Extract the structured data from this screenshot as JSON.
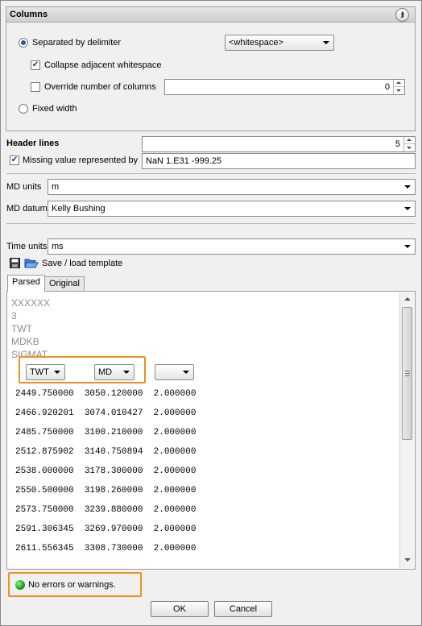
{
  "columns_group": {
    "title": "Columns",
    "separated_label": "Separated by delimiter",
    "delimiter_value": "<whitespace>",
    "collapse_label": "Collapse adjacent whitespace",
    "override_label": "Override number of columns",
    "override_value": "0",
    "fixed_width_label": "Fixed width"
  },
  "header_lines": {
    "label": "Header lines",
    "value": "5"
  },
  "missing_value": {
    "label": "Missing value represented by",
    "value": "NaN 1.E31 -999.25"
  },
  "md_units": {
    "label": "MD units",
    "value": "m"
  },
  "md_datum": {
    "label": "MD datum",
    "value": "Kelly Bushing"
  },
  "time_units": {
    "label": "Time units",
    "value": "ms"
  },
  "template": {
    "label": "Save / load template"
  },
  "tabs": [
    {
      "label": "Parsed"
    },
    {
      "label": "Original"
    }
  ],
  "preview": {
    "header_lines": [
      "XXXXXX",
      "3",
      "TWT",
      "MDKB",
      "SIGMAT"
    ],
    "column_selectors": [
      "TWT",
      "MD",
      ""
    ],
    "rows": [
      "2449.750000  3050.120000  2.000000",
      "2466.920201  3074.010427  2.000000",
      "2485.750000  3100.210000  2.000000",
      "2512.875902  3140.750894  2.000000",
      "2538.000000  3178.300000  2.000000",
      "2550.500000  3198.260000  2.000000",
      "2573.750000  3239.880000  2.000000",
      "2591.306345  3269.970000  2.000000",
      "2611.556345  3308.730000  2.000000"
    ]
  },
  "status": {
    "text": "No errors or warnings."
  },
  "buttons": {
    "ok": "OK",
    "cancel": "Cancel"
  }
}
